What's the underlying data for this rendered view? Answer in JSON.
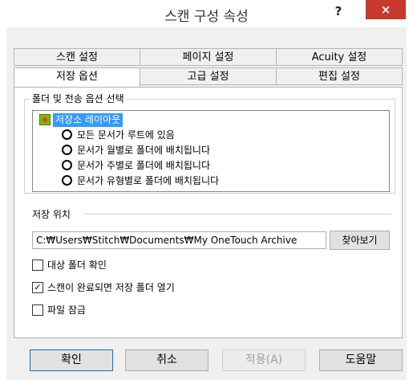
{
  "window": {
    "title": "스캔 구성 속성",
    "help_label": "?",
    "close_label": "×"
  },
  "tabs_row1": [
    "스캔 설정",
    "페이지 설정",
    "Acuity 설정"
  ],
  "tabs_row2": [
    "저장 옵션",
    "고급 설정",
    "편집 설정"
  ],
  "active_tab": "저장 옵션",
  "folder_group": {
    "legend": "폴더 및 전송 옵션 선택",
    "root_label": "저장소 레이아웃",
    "items": [
      "모든 문서가 루트에 있음",
      "문서가 월별로 폴더에 배치됩니다",
      "문서가 주별로 폴더에 배치됩니다",
      "문서가 유형별로 폴더에 배치됩니다"
    ]
  },
  "save_location": {
    "label": "저장 위치",
    "path": "C:₩Users₩Stitch₩Documents₩My OneTouch Archive",
    "browse_label": "찾아보기"
  },
  "checkboxes": [
    {
      "label": "대상 폴더 확인",
      "checked": false
    },
    {
      "label": "스캔이 완료되면 저장 폴더 열기",
      "checked": true
    },
    {
      "label": "파일 잠금",
      "checked": false
    }
  ],
  "buttons": {
    "ok": "확인",
    "cancel": "취소",
    "apply": "적용(A)",
    "help": "도움말"
  }
}
